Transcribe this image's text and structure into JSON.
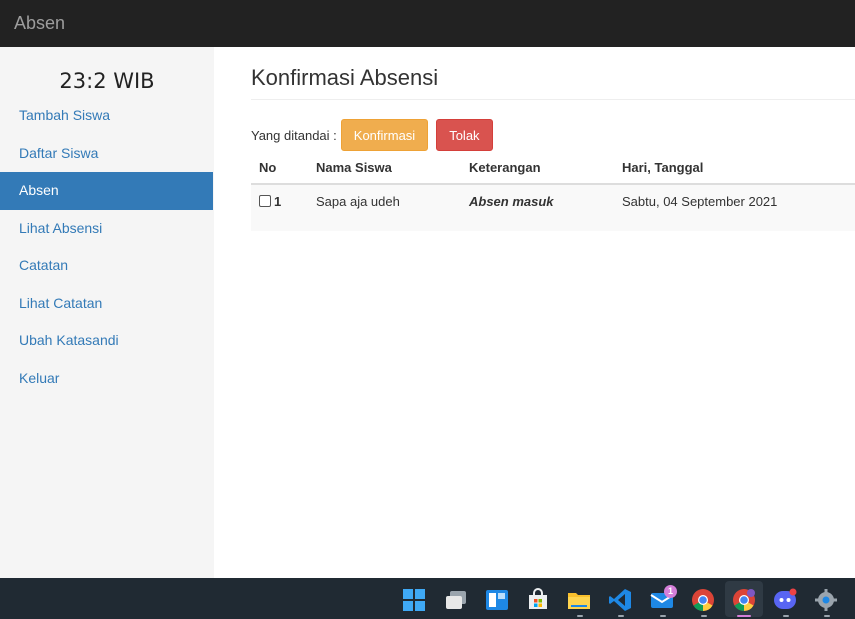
{
  "navbar": {
    "brand": "Absen"
  },
  "sidebar": {
    "clock": "23:2 WIB",
    "items": [
      {
        "label": "Tambah Siswa",
        "active": false
      },
      {
        "label": "Daftar Siswa",
        "active": false
      },
      {
        "label": "Absen",
        "active": true
      },
      {
        "label": "Lihat Absensi",
        "active": false
      },
      {
        "label": "Catatan",
        "active": false
      },
      {
        "label": "Lihat Catatan",
        "active": false
      },
      {
        "label": "Ubah Katasandi",
        "active": false
      },
      {
        "label": "Keluar",
        "active": false
      }
    ]
  },
  "main": {
    "title": "Konfirmasi Absensi",
    "actions": {
      "label": "Yang ditandai :",
      "confirm_label": "Konfirmasi",
      "reject_label": "Tolak"
    },
    "table": {
      "headers": [
        "No",
        "Nama Siswa",
        "Keterangan",
        "Hari, Tanggal"
      ],
      "rows": [
        {
          "no": "1",
          "nama": "Sapa aja udeh",
          "keterangan": "Absen masuk",
          "tanggal": "Sabtu, 04 September 2021",
          "checked": false
        }
      ]
    }
  },
  "taskbar": {
    "icons": [
      "windows-start-icon",
      "task-view-icon",
      "widgets-icon",
      "store-icon",
      "file-explorer-icon",
      "vscode-icon",
      "mail-icon",
      "chrome-icon",
      "chrome-profile-icon",
      "discord-icon",
      "settings-icon"
    ],
    "mail_badge": "1"
  },
  "colors": {
    "navbar": "#222222",
    "sidebar": "#f5f5f5",
    "link": "#337ab7",
    "warning": "#f0ad4e",
    "danger": "#d9534f",
    "taskbar": "#202a33"
  }
}
